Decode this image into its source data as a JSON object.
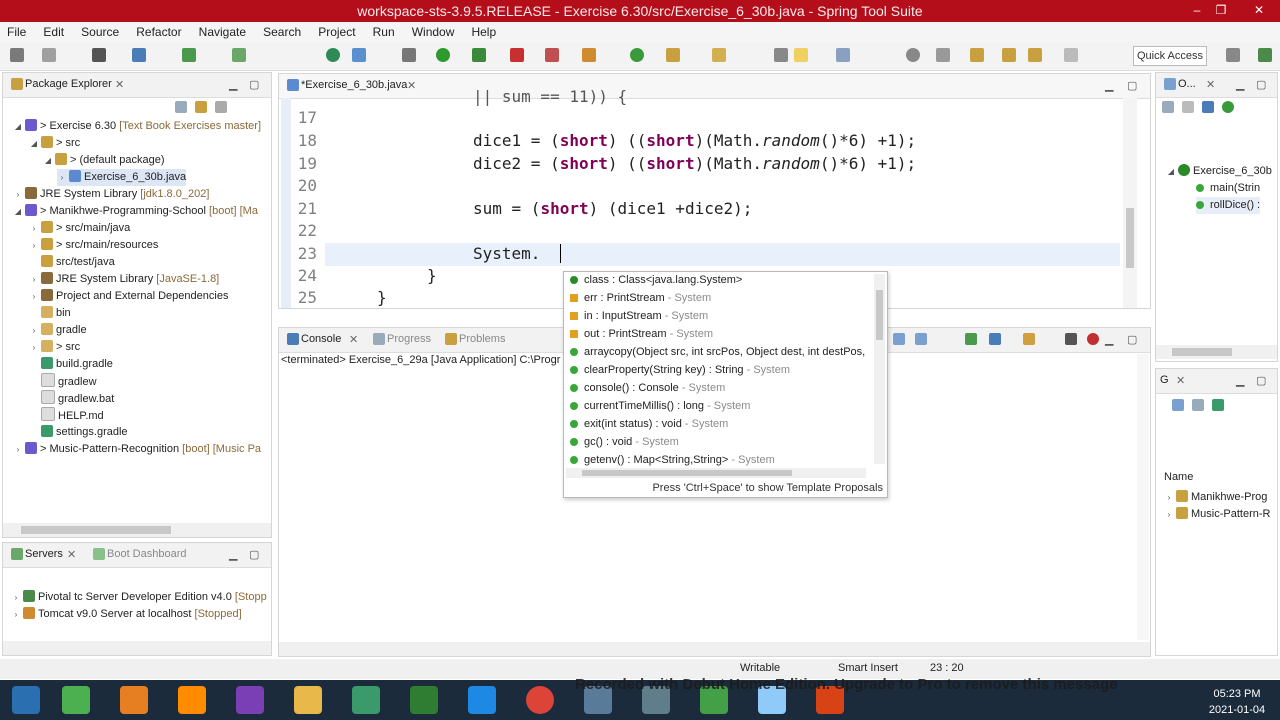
{
  "window": {
    "title": "workspace-sts-3.9.5.RELEASE - Exercise 6.30/src/Exercise_6_30b.java - Spring Tool Suite",
    "controls": [
      "–",
      "❐",
      "✕"
    ]
  },
  "menu": [
    "File",
    "Edit",
    "Source",
    "Refactor",
    "Navigate",
    "Search",
    "Project",
    "Run",
    "Window",
    "Help"
  ],
  "toolbar": {
    "quick_access": "Quick Access"
  },
  "package_explorer": {
    "tab": "Package Explorer",
    "items": [
      {
        "label": "> Exercise 6.30",
        "extra": "[Text Book Exercises master]"
      },
      {
        "label": "> src",
        "extra": ""
      },
      {
        "label": "> (default package)",
        "extra": ""
      },
      {
        "label": "Exercise_6_30b.java",
        "extra": ""
      },
      {
        "label": "JRE System Library",
        "extra": "[jdk1.8.0_202]"
      },
      {
        "label": "> Manikhwe-Programming-School",
        "extra": "[boot] [Ma"
      },
      {
        "label": "> src/main/java",
        "extra": ""
      },
      {
        "label": "> src/main/resources",
        "extra": ""
      },
      {
        "label": "src/test/java",
        "extra": ""
      },
      {
        "label": "JRE System Library",
        "extra": "[JavaSE-1.8]"
      },
      {
        "label": "Project and External Dependencies",
        "extra": ""
      },
      {
        "label": "bin",
        "extra": ""
      },
      {
        "label": "gradle",
        "extra": ""
      },
      {
        "label": "> src",
        "extra": ""
      },
      {
        "label": "build.gradle",
        "extra": ""
      },
      {
        "label": "gradlew",
        "extra": ""
      },
      {
        "label": "gradlew.bat",
        "extra": ""
      },
      {
        "label": "HELP.md",
        "extra": ""
      },
      {
        "label": "settings.gradle",
        "extra": ""
      },
      {
        "label": "> Music-Pattern-Recognition",
        "extra": "[boot] [Music Pa"
      }
    ]
  },
  "servers": {
    "tabs": [
      "Servers",
      "Boot Dashboard"
    ],
    "items": [
      {
        "label": "Pivotal tc Server Developer Edition v4.0",
        "extra": "[Stopp"
      },
      {
        "label": "Tomcat v9.0 Server at localhost",
        "extra": "[Stopped]"
      }
    ]
  },
  "editor": {
    "tab": "*Exercise_6_30b.java",
    "partial_top": "|| sum == 11)) {",
    "lines": [
      {
        "n": "17",
        "code": ""
      },
      {
        "n": "18",
        "code": "dice1 = (short) ((short)(Math.random()*6) +1);"
      },
      {
        "n": "19",
        "code": "dice2 = (short) ((short)(Math.random()*6) +1);"
      },
      {
        "n": "20",
        "code": ""
      },
      {
        "n": "21",
        "code": "sum = (short) (dice1 +dice2);"
      },
      {
        "n": "22",
        "code": ""
      },
      {
        "n": "23",
        "code": "System."
      },
      {
        "n": "24",
        "code": "}"
      },
      {
        "n": "25",
        "code": "}"
      }
    ]
  },
  "console": {
    "tabs": [
      "Console",
      "Progress",
      "Problems"
    ],
    "line": "<terminated> Exercise_6_29a [Java Application] C:\\Progr"
  },
  "autocomplete": {
    "items": [
      {
        "name": "class : Class<java.lang.System>",
        "type": ""
      },
      {
        "name": "err : PrintStream",
        "type": " - System"
      },
      {
        "name": "in : InputStream",
        "type": " - System"
      },
      {
        "name": "out : PrintStream",
        "type": " - System"
      },
      {
        "name": "arraycopy(Object src, int srcPos, Object dest, int destPos,",
        "type": ""
      },
      {
        "name": "clearProperty(String key) : String",
        "type": " - System"
      },
      {
        "name": "console() : Console",
        "type": " - System"
      },
      {
        "name": "currentTimeMillis() : long",
        "type": " - System"
      },
      {
        "name": "exit(int status) : void",
        "type": " - System"
      },
      {
        "name": "gc() : void",
        "type": " - System"
      },
      {
        "name": "getenv() : Map<String,String>",
        "type": " - System"
      }
    ],
    "hint": "Press 'Ctrl+Space' to show Template Proposals"
  },
  "outline": {
    "tab": "O...",
    "items": [
      "Exercise_6_30b",
      "main(Strin",
      "rollDice() :"
    ]
  },
  "gradle": {
    "tab": "G",
    "column": "Name",
    "items": [
      "Manikhwe-Prog",
      "Music-Pattern-R"
    ]
  },
  "status": {
    "writable": "Writable",
    "insert": "Smart Insert",
    "position": "23 : 20"
  },
  "watermark": "Recorded with Debut Home Edition. Upgrade to Pro to remove this message",
  "clock": {
    "time": "05:23 PM",
    "date": "2021-01-04"
  }
}
